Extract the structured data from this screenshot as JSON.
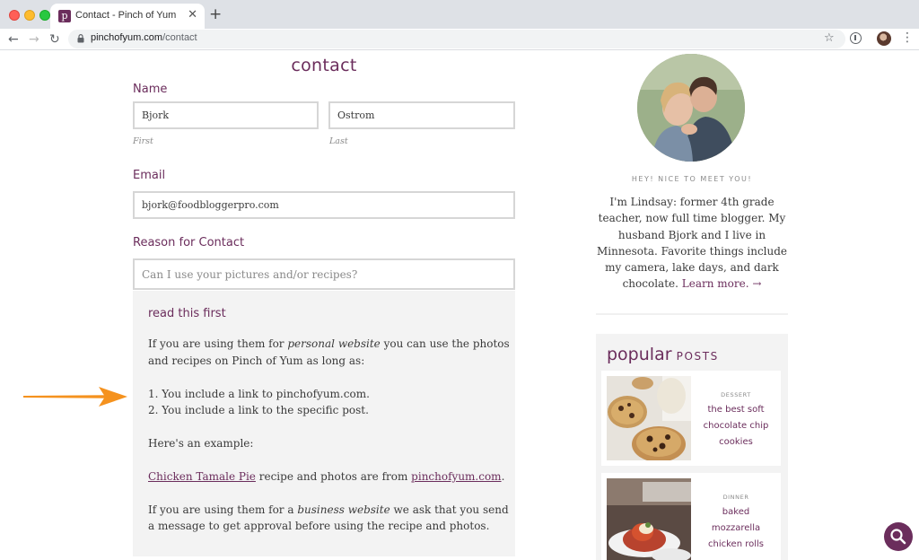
{
  "browser": {
    "tab_title": "Contact - Pinch of Yum",
    "tab_favicon": "p",
    "close_glyph": "✕",
    "newtab_glyph": "+",
    "url_host": "pinchofyum.com",
    "url_path": "/contact"
  },
  "page": {
    "title": "contact"
  },
  "form": {
    "name_label": "Name",
    "first_value": "Bjork",
    "first_sub": "First",
    "last_value": "Ostrom",
    "last_sub": "Last",
    "email_label": "Email",
    "email_value": "bjork@foodbloggerpro.com",
    "reason_label": "Reason for Contact",
    "reason_value": "Can I use your pictures and/or recipes?"
  },
  "info": {
    "title": "read this first",
    "p1_pre": "If you are using them for ",
    "p1_em": "personal website",
    "p1_post": " you can use the photos",
    "p1_line2": "and recipes on Pinch of Yum as long as:",
    "item1": "1. You include a link to pinchofyum.com.",
    "item2": "2. You include a link to the specific post.",
    "example_label": "Here's an example:",
    "example_link": "Chicken Tamale Pie",
    "example_mid": " recipe and photos are from ",
    "example_site": "pinchofyum.com",
    "example_end": ".",
    "p2_pre": "If you are using them for a ",
    "p2_em": "business website",
    "p2_post": " we ask that you send",
    "p2_line2": "a message to get approval before using the recipe and photos."
  },
  "sidebar": {
    "hey": "HEY! NICE TO MEET YOU!",
    "bio_lines": [
      "I'm Lindsay: former 4th grade",
      "teacher, now full time blogger. My",
      "husband Bjork and I live in",
      "Minnesota. Favorite things include",
      "my camera, lake days, and dark",
      "chocolate."
    ],
    "learn_more": "Learn more. →",
    "popular_word": "popular",
    "posts_word": "POSTS",
    "posts": [
      {
        "category": "DESSERT",
        "title_lines": [
          "the best soft",
          "chocolate chip",
          "cookies"
        ]
      },
      {
        "category": "DINNER",
        "title_lines": [
          "baked",
          "mozzarella",
          "chicken rolls"
        ]
      }
    ]
  },
  "colors": {
    "brand": "#6b2d5c",
    "annotation_arrow": "#f5921e"
  }
}
